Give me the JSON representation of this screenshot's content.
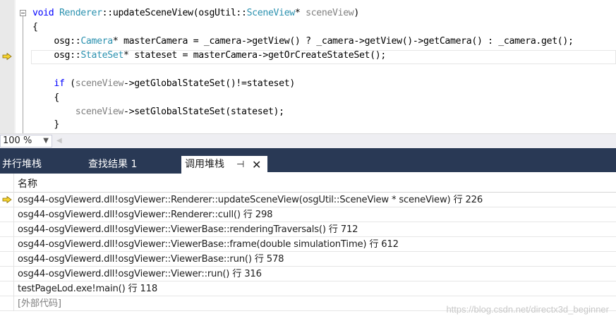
{
  "editor": {
    "lines": [
      {
        "parts": [
          {
            "t": "void",
            "c": "kw"
          },
          {
            "t": " "
          },
          {
            "t": "Renderer",
            "c": "ty"
          },
          {
            "t": "::updateSceneView(osgUtil::"
          },
          {
            "t": "SceneView",
            "c": "ty"
          },
          {
            "t": "* "
          },
          {
            "t": "sceneView",
            "c": "pm"
          },
          {
            "t": ")"
          }
        ]
      },
      {
        "parts": [
          {
            "t": "{"
          }
        ]
      },
      {
        "parts": [
          {
            "t": "    osg::"
          },
          {
            "t": "Camera",
            "c": "ty"
          },
          {
            "t": "* masterCamera = _camera->getView() ? _camera->getView()->getCamera() : _camera.get();"
          }
        ]
      },
      {
        "parts": [
          {
            "t": "    osg::"
          },
          {
            "t": "StateSet",
            "c": "ty"
          },
          {
            "t": "* stateset = masterCamera->getOrCreateStateSet();"
          }
        ]
      },
      {
        "parts": [
          {
            "t": ""
          }
        ]
      },
      {
        "parts": [
          {
            "t": "    "
          },
          {
            "t": "if",
            "c": "kw"
          },
          {
            "t": " ("
          },
          {
            "t": "sceneView",
            "c": "pm"
          },
          {
            "t": "->getGlobalStateSet()!=stateset)"
          }
        ]
      },
      {
        "parts": [
          {
            "t": "    {"
          }
        ]
      },
      {
        "parts": [
          {
            "t": "        "
          },
          {
            "t": "sceneView",
            "c": "pm"
          },
          {
            "t": "->setGlobalStateSet(stateset);"
          }
        ]
      },
      {
        "parts": [
          {
            "t": "    }"
          }
        ]
      }
    ]
  },
  "zoom": {
    "value": "100 %"
  },
  "tabs": {
    "parallel_stacks": "并行堆栈",
    "find_results": "查找结果 1",
    "call_stack": "调用堆栈"
  },
  "call_stack": {
    "column_header": "名称",
    "rows": [
      "osg44-osgViewerd.dll!osgViewer::Renderer::updateSceneView(osgUtil::SceneView * sceneView) 行 226",
      "osg44-osgViewerd.dll!osgViewer::Renderer::cull() 行 298",
      "osg44-osgViewerd.dll!osgViewer::ViewerBase::renderingTraversals() 行 712",
      "osg44-osgViewerd.dll!osgViewer::ViewerBase::frame(double simulationTime) 行 612",
      "osg44-osgViewerd.dll!osgViewer::ViewerBase::run() 行 578",
      "osg44-osgViewerd.dll!osgViewer::Viewer::run() 行 316",
      "testPageLod.exe!main() 行 118",
      "[外部代码]"
    ]
  },
  "watermark": "https://blog.csdn.net/directx3d_beginner",
  "colors": {
    "keyword": "#0000ff",
    "type": "#2b91af",
    "param": "#808080",
    "tab_strip": "#293955",
    "exec_arrow": "#f5d32f"
  },
  "icons": {
    "current_statement": "yellow-arrow-icon",
    "pin": "pin-icon",
    "close": "close-icon"
  }
}
